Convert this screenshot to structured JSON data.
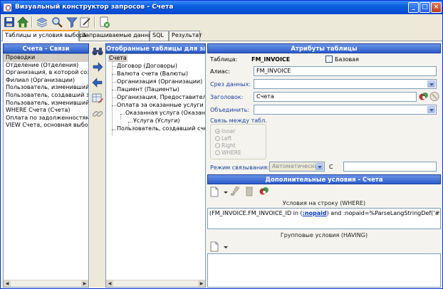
{
  "window": {
    "title": "Визуальный конструктор запросов - Счета",
    "controls": {
      "minimize": "_",
      "maximize": "□",
      "close": "×"
    }
  },
  "toolbar": {
    "icons": [
      "save-icon",
      "home-icon",
      "layers-icon",
      "search-icon",
      "filter-icon",
      "edit-icon",
      "document-clear-icon"
    ]
  },
  "tabs": [
    {
      "label": "Таблицы и условия выбора",
      "active": true
    },
    {
      "label": "Запрашиваемые данные",
      "active": false
    },
    {
      "label": "SQL",
      "active": false
    },
    {
      "label": "Результат",
      "active": false
    }
  ],
  "left_panel": {
    "title": "Счета - Связи",
    "items": [
      "Проводки",
      "Отделение (Отделения)",
      "Организация, в которой создан",
      "Филиал (Организации)",
      "Пользователь, изменивший сч",
      "Пользователь, создавший запи",
      "Пользователь, изменивший запи",
      "WHERE Счета (Счета)",
      "Оплата по задолженностям за",
      "VIEW Счета,  основная выборка"
    ]
  },
  "middle_panel": {
    "title": "Отобранные таблицы для запроса",
    "tree": [
      {
        "label": "Счета",
        "level": 0
      },
      {
        "label": "Договор (Договоры)",
        "level": 1
      },
      {
        "label": "Валюта счета (Валюты)",
        "level": 1
      },
      {
        "label": "Организация (Организации)",
        "level": 1
      },
      {
        "label": "Пациент (Пациенты)",
        "level": 1
      },
      {
        "label": "Организация, Предоставитель сч",
        "level": 1
      },
      {
        "label": "Оплата за оказанные услуги (Счет",
        "level": 1
      },
      {
        "label": "Оказанная услуга (Оказанные",
        "level": 2
      },
      {
        "label": "Услуга (Услуги)",
        "level": 3
      },
      {
        "label": "Пользователь, создавший счет (Вр",
        "level": 1
      }
    ]
  },
  "attributes": {
    "title": "Атрибуты таблицы",
    "table_label": "Таблица:",
    "table_value": "FM_INVOICE",
    "base_label": "Базовая",
    "alias_label": "Алиас:",
    "alias_value": "FM_INVOICE",
    "slice_label": "Срез данных:",
    "slice_value": "",
    "header_label": "Заголовок:",
    "header_value": "Счета",
    "merge_label": "Объединить:",
    "merge_value": "",
    "link_label": "Связь между табл.",
    "link_options": [
      "Inner",
      "Left",
      "Right",
      "WHERE"
    ],
    "link_mode_label": "Режим связывания:",
    "link_mode_value": "Автоматически",
    "link_c_label": "С",
    "link_c_value": ""
  },
  "extra": {
    "title": "Дополнительные условия - Счета",
    "where_header": "Условия на строку (WHERE)",
    "where_text_1": "(FM_INVOICE.FM_INVOICE_ID in (",
    "where_param": ":nopaid",
    "where_text_2": ") and :nopaid=%ParseLangStringDef('#fra#OUI#",
    "having_header": "Групповые условия (HAVING)"
  }
}
